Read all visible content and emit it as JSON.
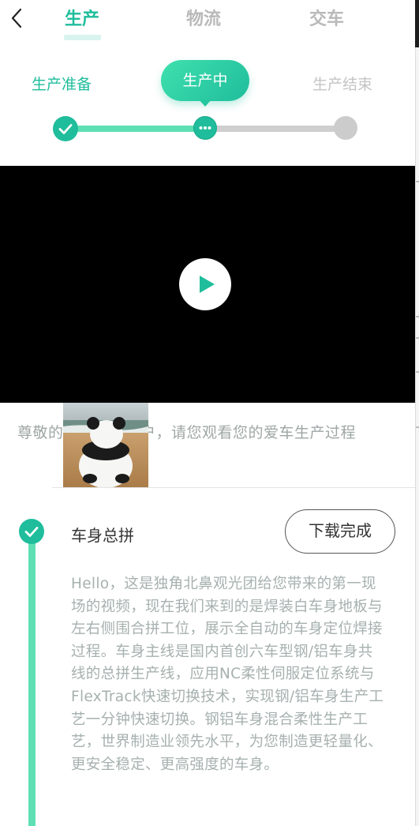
{
  "top_nav": {
    "tabs": [
      {
        "label": "生产",
        "active": true
      },
      {
        "label": "物流",
        "active": false
      },
      {
        "label": "交车",
        "active": false
      }
    ]
  },
  "stages": {
    "items": [
      {
        "label": "生产准备",
        "status": "done"
      },
      {
        "label": "生产中",
        "status": "current"
      },
      {
        "label": "生产结束",
        "status": "pending"
      }
    ]
  },
  "video": {
    "state": "paused"
  },
  "greeting": {
    "text": "尊敬的　　　　　户，请您观看您的爱车生产过程"
  },
  "step": {
    "title": "车身总拼",
    "download_label": "下载完成",
    "description": "Hello，这是独角北鼻观光团给您带来的第一现场的视频，现在我们来到的是焊装白车身地板与左右侧围合拼工位，展示全自动的车身定位焊接过程。车身主线是国内首创六车型钢/铝车身共线的总拼生产线，应用NC柔性伺服定位系统与FlexTrack快速切换技术，实现钢/铝车身生产工艺一分钟快速切换。钢铝车身混合柔性生产工艺，世界制造业领先水平，为您制造更轻量化、更安全稳定、更高强度的车身。"
  },
  "icons": {
    "back": "chevron-left-icon",
    "check": "check-icon",
    "current": "more-dots-icon",
    "play": "play-icon"
  },
  "colors": {
    "accent": "#1fbd9c",
    "accent_light": "#5ee0b4",
    "inactive": "#cfcfcf"
  }
}
